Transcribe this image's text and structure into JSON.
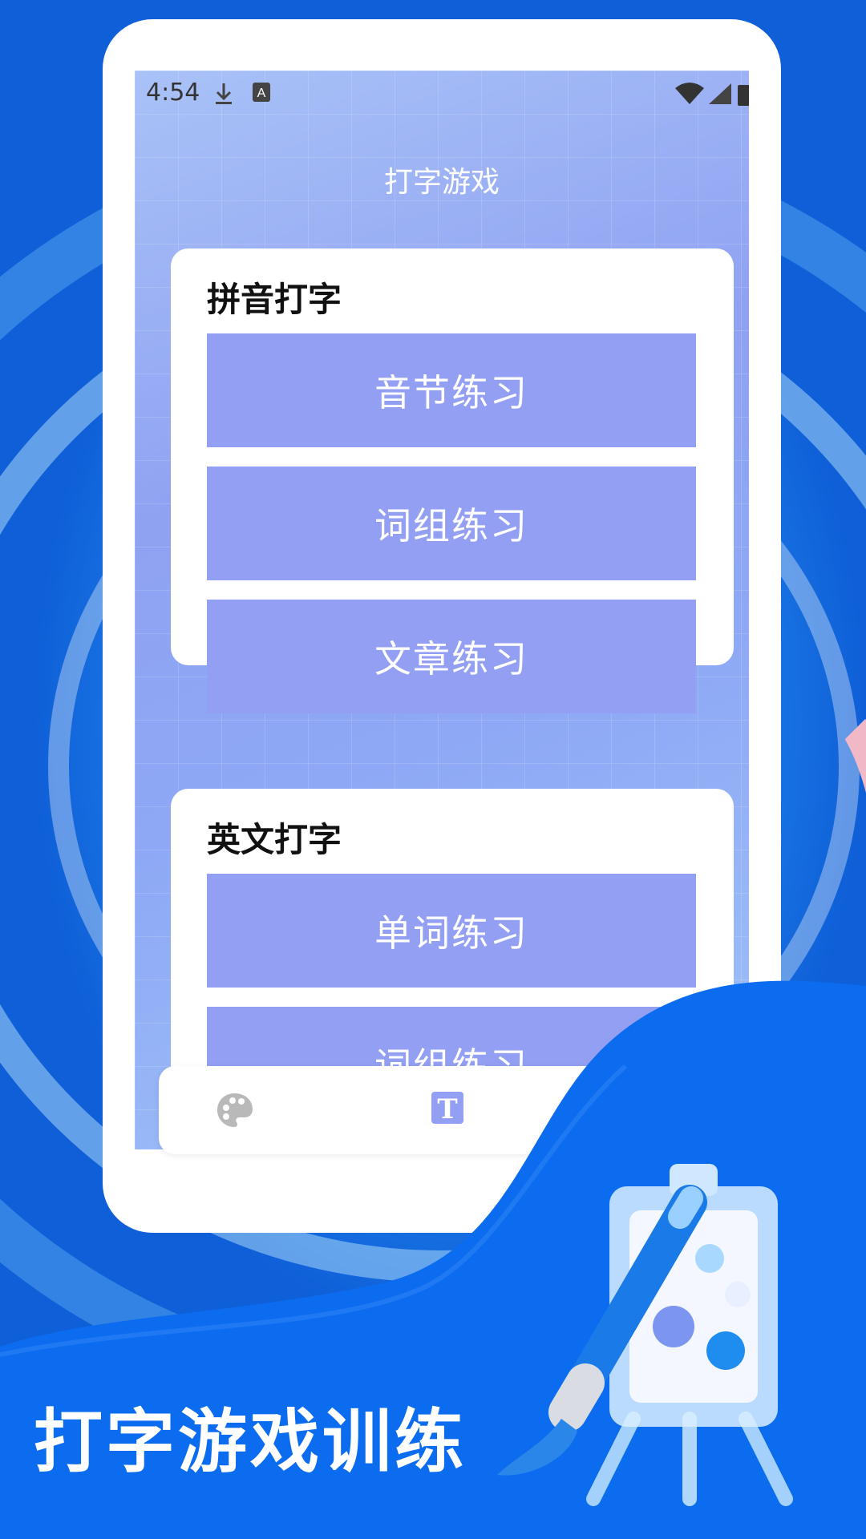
{
  "status_bar": {
    "time": "4:54"
  },
  "app": {
    "title": "打字游戏"
  },
  "sections": [
    {
      "title": "拼音打字",
      "buttons": [
        "音节练习",
        "词组练习",
        "文章练习"
      ]
    },
    {
      "title": "英文打字",
      "buttons": [
        "单词练习",
        "词组练习"
      ]
    }
  ],
  "bottom_nav": {
    "items": [
      {
        "icon": "palette-icon"
      },
      {
        "icon": "text-icon",
        "active": true
      }
    ]
  },
  "promo": {
    "headline": "打字游戏训练"
  },
  "colors": {
    "button": "#939ff2",
    "accent_blue": "#0b6cf0",
    "nav_active": "#939ff2"
  }
}
